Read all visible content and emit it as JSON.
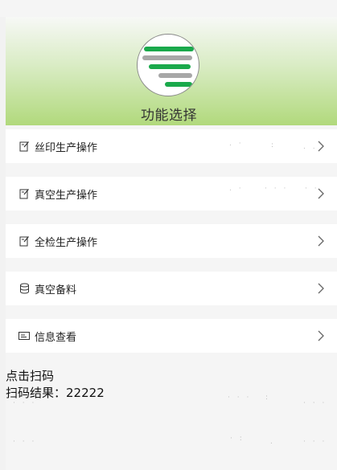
{
  "header": {
    "title": "功能选择",
    "logo_icon": "stripes-logo-icon",
    "colors": {
      "gradient_top": "#f7f8f6",
      "gradient_bottom": "#b1d97c",
      "logo_green": "#1aa94b",
      "logo_gray": "#a7a7a7"
    }
  },
  "menu": {
    "items": [
      {
        "label": "丝印生产操作",
        "icon": "edit-document-icon"
      },
      {
        "label": "真空生产操作",
        "icon": "edit-document-icon"
      },
      {
        "label": "全检生产操作",
        "icon": "edit-document-icon"
      },
      {
        "label": "真空备料",
        "icon": "database-icon"
      },
      {
        "label": "信息查看",
        "icon": "id-card-icon"
      }
    ],
    "chevron_icon": "chevron-right-icon"
  },
  "scan": {
    "action_label": "点击扫码",
    "result_label": "扫码结果：",
    "result_value": "22222"
  }
}
